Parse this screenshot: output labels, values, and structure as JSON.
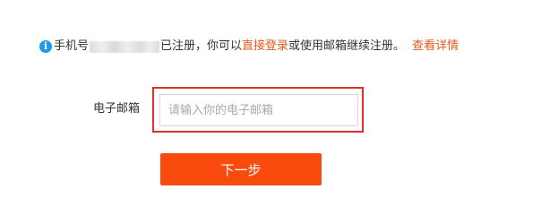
{
  "notice": {
    "icon": "info-icon",
    "icon_glyph": "i",
    "prefix": "手机号",
    "after_mask": "已注册，你可以",
    "login_link": "直接登录",
    "middle": "或使用邮箱继续注册。",
    "detail_link": "查看详情",
    "icon_color": "#1e9be8",
    "link_color": "#e05a1a"
  },
  "form": {
    "email_label": "电子邮箱",
    "email_value": "",
    "email_placeholder": "请输入你的电子邮箱",
    "highlight_color": "#e0302e"
  },
  "actions": {
    "next_label": "下一步",
    "button_color": "#fa4b0f"
  }
}
